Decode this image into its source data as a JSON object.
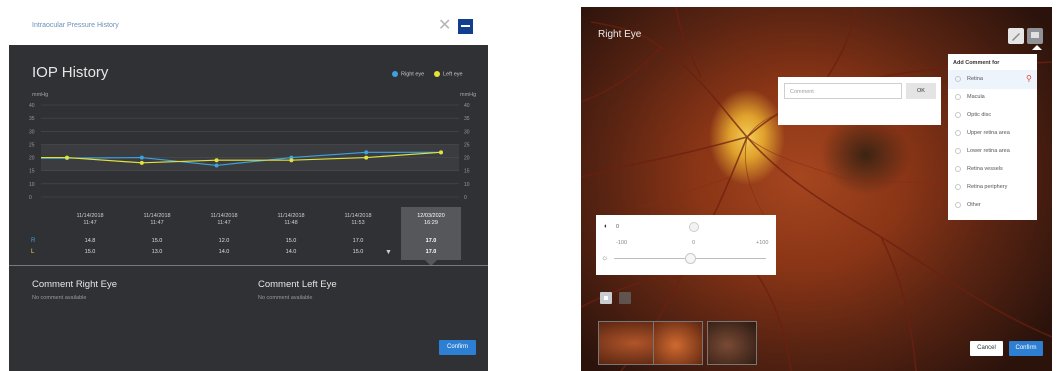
{
  "iop_window": {
    "window_title": "Intraocular Pressure History",
    "title": "IOP History",
    "legend": [
      {
        "label": "Right eye",
        "color": "#3da2e0"
      },
      {
        "label": "Left eye",
        "color": "#e3e23a"
      }
    ],
    "units_left": "mmHg",
    "units_right": "mmHg",
    "columns": [
      {
        "date": "11/14/2018",
        "time": "11:47",
        "r": "14.8",
        "l": "15.0"
      },
      {
        "date": "11/14/2018",
        "time": "11:47",
        "r": "15.0",
        "l": "13.0"
      },
      {
        "date": "11/14/2018",
        "time": "11:47",
        "r": "12.0",
        "l": "14.0"
      },
      {
        "date": "11/14/2018",
        "time": "11:48",
        "r": "15.0",
        "l": "14.0"
      },
      {
        "date": "11/14/2018",
        "time": "11:53",
        "r": "17.0",
        "l": "15.0"
      },
      {
        "date": "12/03/2020",
        "time": "16:29",
        "r": "17.0",
        "l": "17.0"
      }
    ],
    "row_r_label": "R",
    "row_l_label": "L",
    "comment_right_title": "Comment Right Eye",
    "comment_right_text": "No comment available",
    "comment_left_title": "Comment Left Eye",
    "comment_left_text": "No comment available",
    "confirm_label": "Confirm"
  },
  "chart_data": {
    "type": "line",
    "categories": [
      "11/14/2018 11:47",
      "11/14/2018 11:47",
      "11/14/2018 11:47",
      "11/14/2018 11:48",
      "11/14/2018 11:53",
      "12/03/2020 16:29"
    ],
    "ylim": [
      0,
      35
    ],
    "yticks": [
      0,
      5,
      10,
      15,
      20,
      25,
      30,
      35
    ],
    "ytick_labels": [
      "0",
      "10",
      "15",
      "20",
      "25",
      "30",
      "35",
      "40"
    ],
    "series": [
      {
        "values": [
          14.8,
          15.0,
          12.0,
          15.0,
          17.0,
          17.0
        ],
        "color": "#3da2e0"
      },
      {
        "values": [
          15.0,
          13.0,
          14.0,
          14.0,
          15.0,
          17.0
        ],
        "color": "#e3e23a"
      }
    ],
    "grid": true,
    "legend_position": "top-right"
  },
  "eye_view": {
    "title": "Right Eye",
    "comment_input_placeholder": "Comment",
    "ok_label": "OK",
    "menu_header": "Add Comment for",
    "menu_items": [
      "Retina",
      "Macula",
      "Optic disc",
      "Upper retina area",
      "Lower retina area",
      "Retina vessels",
      "Retina periphery",
      "Other"
    ],
    "slider_value_label": "0",
    "slider_min_label": "-100",
    "slider_mid_label": "0",
    "slider_max_label": "+100",
    "slider_level": 0.5,
    "cancel_label": "Cancel",
    "confirm_label": "Confirm",
    "accent_color": "#2c7fd2"
  }
}
